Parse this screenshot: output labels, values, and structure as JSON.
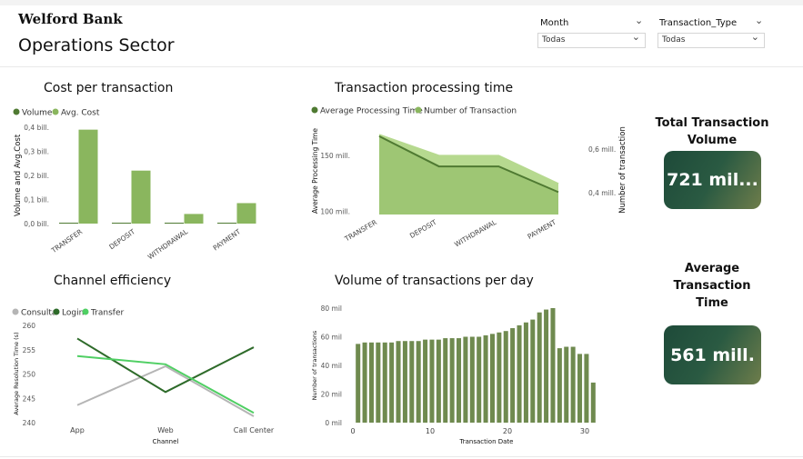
{
  "header": {
    "brand": "Welford Bank",
    "title": "Operations Sector"
  },
  "filters": [
    {
      "label": "Month",
      "value": "Todas"
    },
    {
      "label": "Transaction_Type",
      "value": "Todas"
    }
  ],
  "colors": {
    "dark_green": "#4f7a32",
    "mid_green": "#8ab65e",
    "light_green": "#b6d98f",
    "line_green": "#2e6b2a",
    "bright_green": "#4fcf63",
    "gray": "#b5b5b5",
    "bar_volume": "#6f8a4f"
  },
  "kpis": {
    "volume_title": "Total Transaction Volume",
    "volume_value": "721 mil...",
    "time_title": "Average Transaction Time",
    "time_value": "561 mill."
  },
  "chart_data": [
    {
      "id": "cost",
      "type": "bar",
      "title": "Cost per transaction",
      "legend": [
        "Volume",
        "Avg. Cost"
      ],
      "ylabel": "Volume and Avg.Cost",
      "categories": [
        "TRANSFER",
        "DEPOSIT",
        "WITHDRAWAL",
        "PAYMENT"
      ],
      "series": [
        {
          "name": "Volume",
          "values": [
            0.001,
            0.001,
            0.001,
            0.001
          ]
        },
        {
          "name": "Avg. Cost",
          "values": [
            0.39,
            0.22,
            0.04,
            0.085
          ]
        }
      ],
      "yticks": [
        "0,0 bill.",
        "0,1 bill.",
        "0,2 bill.",
        "0,3 bill.",
        "0,4 bill."
      ],
      "ylim": [
        0,
        0.4
      ]
    },
    {
      "id": "proc",
      "type": "area",
      "title": "Transaction processing time",
      "legend": [
        "Average Processing Time",
        "Number of Transaction"
      ],
      "ylabel": "Average Processing Time",
      "y2label": "Number of transaction",
      "categories": [
        "TRANSFER",
        "DEPOSIT",
        "WITHDRAWAL",
        "PAYMENT"
      ],
      "series": [
        {
          "name": "Average Processing Time",
          "values": [
            167,
            140,
            140,
            117
          ]
        },
        {
          "name": "Number of Transaction",
          "values": [
            0.665,
            0.569,
            0.569,
            0.44
          ]
        }
      ],
      "yticks": [
        "100 mill.",
        "150 mill."
      ],
      "y2ticks": [
        "0,4 mill.",
        "0,6 mill."
      ],
      "ylim": [
        97,
        175
      ],
      "y2lim": [
        0.3,
        0.7
      ]
    },
    {
      "id": "channel",
      "type": "line",
      "title": "Channel efficiency",
      "legend": [
        "Consulta",
        "Login",
        "Transfer"
      ],
      "ylabel": "Average Resolution Time (s)",
      "xlabel": "Channel",
      "categories": [
        "App",
        "Web",
        "Call Center"
      ],
      "series": [
        {
          "name": "Consulta",
          "values": [
            243.6,
            251.6,
            241.3
          ]
        },
        {
          "name": "Login",
          "values": [
            257.3,
            246.3,
            255.5
          ]
        },
        {
          "name": "Transfer",
          "values": [
            253.7,
            252.0,
            242.0
          ]
        }
      ],
      "yticks": [
        "240",
        "245",
        "250",
        "255",
        "260"
      ],
      "ylim": [
        240,
        260
      ]
    },
    {
      "id": "perday",
      "type": "bar",
      "title": "Volume of transactions per day",
      "ylabel": "Number of transactions",
      "xlabel": "Transaction Date",
      "x": [
        1,
        2,
        3,
        4,
        5,
        6,
        7,
        8,
        9,
        10,
        11,
        12,
        13,
        14,
        15,
        16,
        17,
        18,
        19,
        20,
        21,
        22,
        23,
        24,
        25,
        26,
        27,
        28,
        29,
        30,
        31
      ],
      "values": [
        55,
        56,
        56,
        56,
        56,
        56,
        57,
        57,
        57,
        57,
        58,
        58,
        58,
        59,
        59,
        59,
        60,
        60,
        60,
        61,
        62,
        63,
        64,
        66,
        68,
        70,
        72,
        77,
        79,
        80,
        52,
        53,
        53,
        48,
        48,
        28
      ],
      "yticks": [
        "0 mil",
        "20 mil",
        "40 mil",
        "60 mil",
        "80 mil"
      ],
      "xticks": [
        "0",
        "10",
        "20",
        "30"
      ],
      "ylim": [
        0,
        80
      ]
    }
  ]
}
